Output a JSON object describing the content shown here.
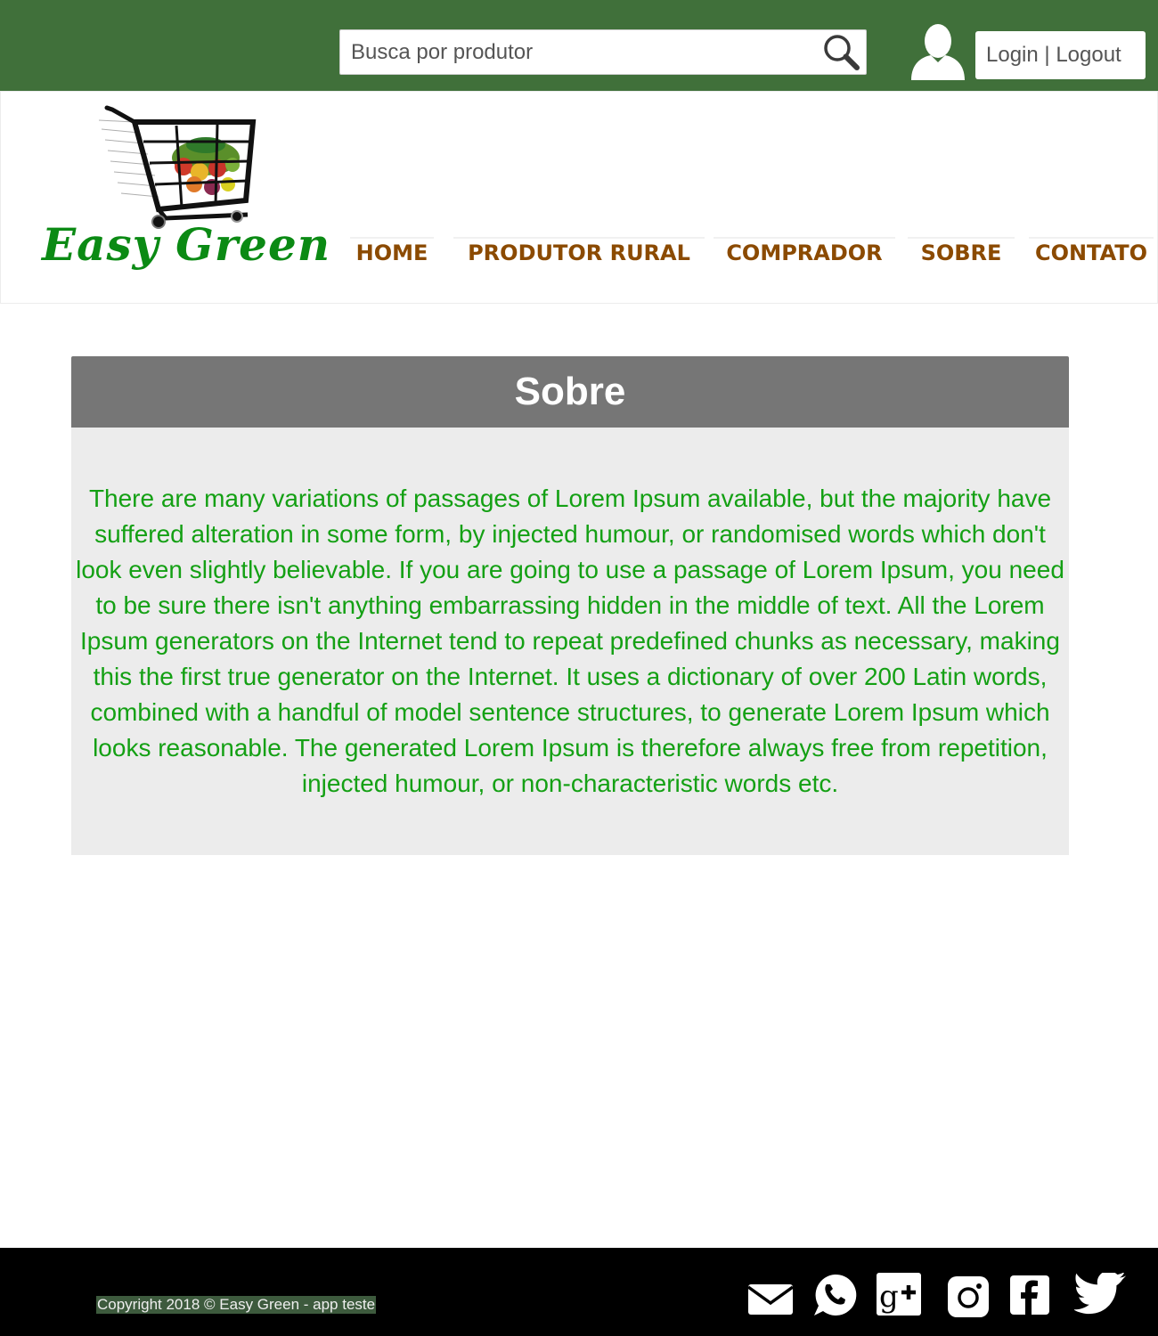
{
  "topbar": {
    "search_placeholder": "Busca por produtor",
    "search_icon": "search-icon",
    "user_icon": "user-icon",
    "login_label": "Login",
    "separator": " | ",
    "logout_label": "Logout"
  },
  "brand": {
    "name": "Easy Green",
    "logo_icon": "shopping-cart-with-vegetables-icon"
  },
  "nav": {
    "items": [
      "HOME",
      "PRODUTOR RURAL",
      "COMPRADOR",
      "SOBRE",
      "CONTATO"
    ]
  },
  "about": {
    "title": "Sobre",
    "text": "There are many variations of passages of Lorem Ipsum available, but the majority have suffered alteration in some form, by injected humour, or randomised words which don't look even slightly believable. If you are going to use a passage of Lorem Ipsum, you need to be sure there isn't anything embarrassing hidden in the middle of text. All the Lorem Ipsum generators on the Internet tend to repeat predefined chunks as necessary, making this the first true generator on the Internet. It uses a dictionary of over 200 Latin words, combined with a handful of model sentence structures, to generate Lorem Ipsum which looks reasonable. The generated Lorem Ipsum is therefore always free from repetition, injected humour, or non-characteristic words etc."
  },
  "footer": {
    "copyright": "Copyright 2018 © Easy Green - app teste",
    "social_icons": [
      "email-icon",
      "whatsapp-icon",
      "google-plus-icon",
      "instagram-icon",
      "facebook-icon",
      "twitter-icon"
    ]
  },
  "colors": {
    "topbar": "#40703a",
    "brand_green": "#0b8a14",
    "nav_brown": "#8b4a00",
    "panel_header": "#767676",
    "panel_body": "#ececec",
    "body_text": "#14a014",
    "footer": "#000000"
  }
}
